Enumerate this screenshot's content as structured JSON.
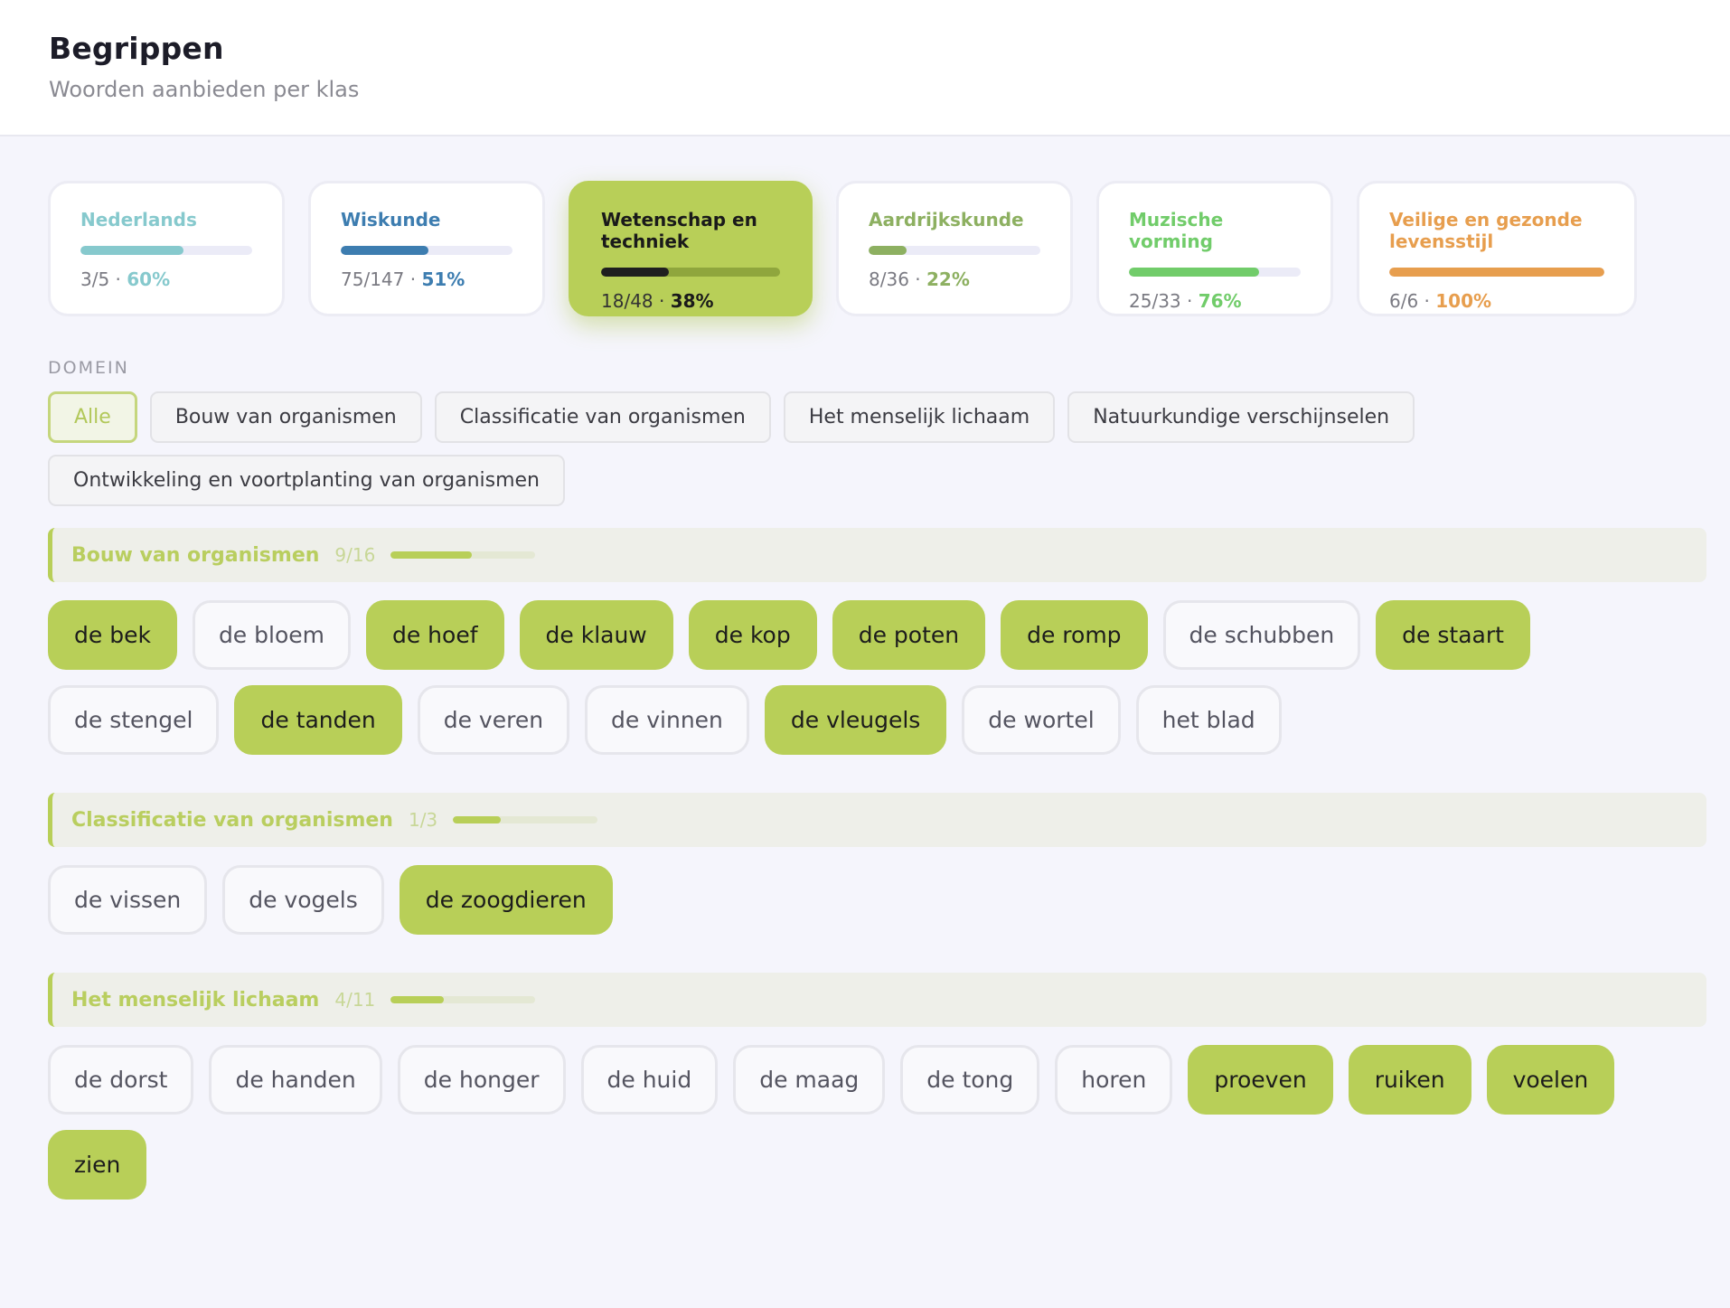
{
  "header": {
    "title": "Begrippen",
    "subtitle": "Woorden aanbieden per klas"
  },
  "subjects": [
    {
      "name": "Nederlands",
      "done": "3/5",
      "pct": "60%",
      "progress": 0.6,
      "color": "#86c9cd",
      "active": false
    },
    {
      "name": "Wiskunde",
      "done": "75/147",
      "pct": "51%",
      "progress": 0.51,
      "color": "#3d7db0",
      "active": false
    },
    {
      "name": "Wetenschap en techniek",
      "done": "18/48",
      "pct": "38%",
      "progress": 0.38,
      "color": "#1f1f1f",
      "active": true
    },
    {
      "name": "Aardrijkskunde",
      "done": "8/36",
      "pct": "22%",
      "progress": 0.22,
      "color": "#8db061",
      "active": false
    },
    {
      "name": "Muzische vorming",
      "done": "25/33",
      "pct": "76%",
      "progress": 0.76,
      "color": "#71cc6a",
      "active": false
    },
    {
      "name": "Veilige en gezonde levensstijl",
      "done": "6/6",
      "pct": "100%",
      "progress": 1.0,
      "color": "#e79e4e",
      "active": false
    }
  ],
  "subject_separator": "·",
  "domain": {
    "label": "DOMEIN",
    "chips": [
      {
        "label": "Alle",
        "active": true
      },
      {
        "label": "Bouw van organismen",
        "active": false
      },
      {
        "label": "Classificatie van organismen",
        "active": false
      },
      {
        "label": "Het menselijk lichaam",
        "active": false
      },
      {
        "label": "Natuurkundige verschijnselen",
        "active": false
      },
      {
        "label": "Ontwikkeling en voortplanting van organismen",
        "active": false
      }
    ]
  },
  "groups": [
    {
      "name": "Bouw van organismen",
      "count": "9/16",
      "progress": 0.5625,
      "words": [
        {
          "text": "de bek",
          "on": true
        },
        {
          "text": "de bloem",
          "on": false
        },
        {
          "text": "de hoef",
          "on": true
        },
        {
          "text": "de klauw",
          "on": true
        },
        {
          "text": "de kop",
          "on": true
        },
        {
          "text": "de poten",
          "on": true
        },
        {
          "text": "de romp",
          "on": true
        },
        {
          "text": "de schubben",
          "on": false
        },
        {
          "text": "de staart",
          "on": true
        },
        {
          "text": "de stengel",
          "on": false
        },
        {
          "text": "de tanden",
          "on": true
        },
        {
          "text": "de veren",
          "on": false
        },
        {
          "text": "de vinnen",
          "on": false
        },
        {
          "text": "de vleugels",
          "on": true
        },
        {
          "text": "de wortel",
          "on": false
        },
        {
          "text": "het blad",
          "on": false
        }
      ]
    },
    {
      "name": "Classificatie van organismen",
      "count": "1/3",
      "progress": 0.333,
      "words": [
        {
          "text": "de vissen",
          "on": false
        },
        {
          "text": "de vogels",
          "on": false
        },
        {
          "text": "de zoogdieren",
          "on": true
        }
      ]
    },
    {
      "name": "Het menselijk lichaam",
      "count": "4/11",
      "progress": 0.364,
      "words": [
        {
          "text": "de dorst",
          "on": false
        },
        {
          "text": "de handen",
          "on": false
        },
        {
          "text": "de honger",
          "on": false
        },
        {
          "text": "de huid",
          "on": false
        },
        {
          "text": "de maag",
          "on": false
        },
        {
          "text": "de tong",
          "on": false
        },
        {
          "text": "horen",
          "on": false
        },
        {
          "text": "proeven",
          "on": true
        },
        {
          "text": "ruiken",
          "on": true
        },
        {
          "text": "voelen",
          "on": true
        },
        {
          "text": "zien",
          "on": true
        }
      ]
    }
  ]
}
